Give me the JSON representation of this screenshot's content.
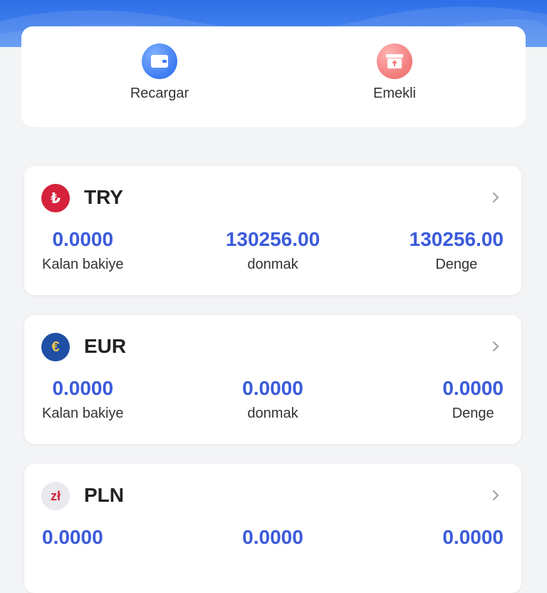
{
  "actions": {
    "recharge_label": "Recargar",
    "withdraw_label": "Emekli"
  },
  "wallets": [
    {
      "code": "TRY",
      "symbol": "₺",
      "remaining": "0.0000",
      "frozen": "130256.00",
      "balance": "130256.00",
      "remaining_label": "Kalan bakiye",
      "frozen_label": "donmak",
      "balance_label": "Denge"
    },
    {
      "code": "EUR",
      "symbol": "€",
      "remaining": "0.0000",
      "frozen": "0.0000",
      "balance": "0.0000",
      "remaining_label": "Kalan bakiye",
      "frozen_label": "donmak",
      "balance_label": "Denge"
    },
    {
      "code": "PLN",
      "symbol": "zł",
      "remaining": "0.0000",
      "frozen": "0.0000",
      "balance": "0.0000"
    }
  ],
  "colors": {
    "accent": "#3b5bdb",
    "banner": "#2f6fe8",
    "try_icon": "#d5213b",
    "eur_icon": "#1f4fa5"
  }
}
